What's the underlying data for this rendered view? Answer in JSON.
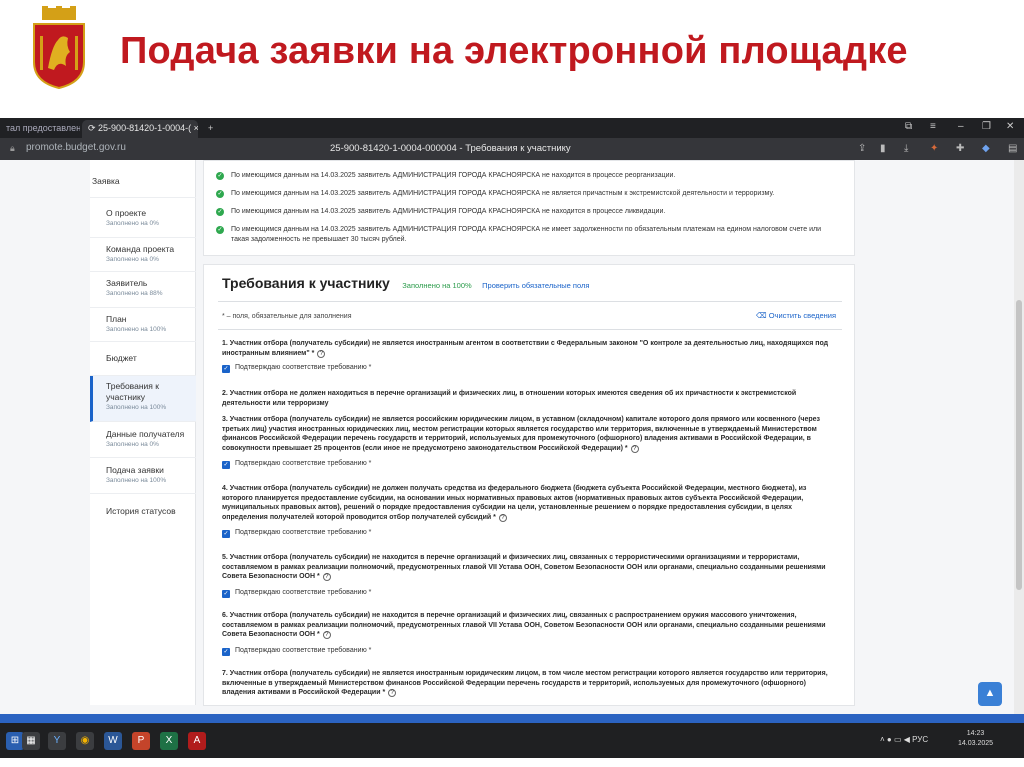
{
  "slide": {
    "title": "Подача заявки на электронной площадке",
    "accent_color": "#c0191f",
    "emblem_icon": "krasnoyarsk-coat-of-arms"
  },
  "browser": {
    "tabs": [
      {
        "label": "тал предоставлени"
      },
      {
        "label": "25-900-81420-1-0004-("
      }
    ],
    "url": "promote.budget.gov.ru",
    "page_title": "25-900-81420-1-0004-000004 - Требования к участнику"
  },
  "sidebar": {
    "items": [
      {
        "label": "Заявка",
        "sub": ""
      },
      {
        "label": "О проекте",
        "sub": "Заполнено на 0%"
      },
      {
        "label": "Команда проекта",
        "sub": "Заполнено на 0%"
      },
      {
        "label": "Заявитель",
        "sub": "Заполнено на 88%"
      },
      {
        "label": "План",
        "sub": "Заполнено на 100%"
      },
      {
        "label": "Бюджет",
        "sub": ""
      },
      {
        "label": "Требования к участнику",
        "sub": "Заполнено на 100%"
      },
      {
        "label": "Данные получателя",
        "sub": "Заполнено на 0%"
      },
      {
        "label": "Подача заявки",
        "sub": "Заполнено на 100%"
      },
      {
        "label": "История статусов",
        "sub": ""
      }
    ]
  },
  "checks": [
    "По имеющимся данным на 14.03.2025 заявитель АДМИНИСТРАЦИЯ ГОРОДА КРАСНОЯРСКА не находится в процессе реорганизации.",
    "По имеющимся данным на 14.03.2025 заявитель АДМИНИСТРАЦИЯ ГОРОДА КРАСНОЯРСКА не является причастным к экстремистской деятельности и терроризму.",
    "По имеющимся данным на 14.03.2025 заявитель АДМИНИСТРАЦИЯ ГОРОДА КРАСНОЯРСКА не находится в процессе ликвидации.",
    "По имеющимся данным на 14.03.2025 заявитель АДМИНИСТРАЦИЯ ГОРОДА КРАСНОЯРСКА не имеет задолженности по обязательным платежам на едином налоговом счете или такая задолженность не превышает 30 тысяч рублей."
  ],
  "section": {
    "title": "Требования к участнику",
    "filled": "Заполнено на 100%",
    "check_link": "Проверить обязательные поля",
    "required_note": "* – поля, обязательные для заполнения",
    "clear_label": "Очистить сведения",
    "confirm_label": "Подтверждаю соответствие требованию *"
  },
  "questions": [
    "1. Участник отбора (получатель субсидии) не является иностранным агентом в соответствии с Федеральным законом \"О контроле за деятельностью лиц, находящихся под иностранным влиянием\" *",
    "2. Участник отбора не должен находиться в перечне организаций и физических лиц, в отношении которых имеются сведения об их причастности к экстремистской деятельности или терроризму",
    "3. Участник отбора (получатель субсидии) не является российским юридическим лицом, в уставном (складочном) капитале которого доля прямого или косвенного (через третьих лиц) участия иностранных юридических лиц, местом регистрации которых является государство или территория, включенные в утверждаемый Министерством финансов Российской Федерации перечень государств и территорий, используемых для промежуточного (офшорного) владения активами в Российской Федерации, в совокупности превышает 25 процентов (если иное не предусмотрено законодательством Российской Федерации) *",
    "4. Участник отбора (получатель субсидии) не должен получать средства из федерального бюджета (бюджета субъекта Российской Федерации, местного бюджета), из которого планируется предоставление субсидии, на основании иных нормативных правовых актов (нормативных правовых актов субъекта Российской Федерации, муниципальных правовых актов), решений о порядке предоставления субсидии на цели, установленные решением о порядке предоставления субсидии, в целях определения получателей которой проводится отбор получателей субсидий *",
    "5. Участник отбора (получатель субсидии) не находится в перечне организаций и физических лиц, связанных с террористическими организациями и террористами, составляемом в рамках реализации полномочий, предусмотренных главой VII Устава ООН, Советом Безопасности ООН или органами, специально созданными решениями Совета Безопасности ООН *",
    "6. Участник отбора (получатель субсидии) не находится в перечне организаций и физических лиц, связанных с распространением оружия массового уничтожения, составляемом в рамках реализации полномочий, предусмотренных главой VII Устава ООН, Советом Безопасности ООН или органами, специально созданными решениями Совета Безопасности ООН *",
    "7. Участник отбора (получатель субсидии) не является иностранным юридическим лицом, в том числе местом регистрации которого является государство или территория, включенные в утверждаемый Министерством финансов Российской Федерации перечень государств и территорий, используемых для промежуточного (офшорного) владения активами в Российской Федерации *"
  ],
  "taskbar": {
    "lang": "РУС",
    "time": "14:23",
    "date": "14.03.2025"
  }
}
